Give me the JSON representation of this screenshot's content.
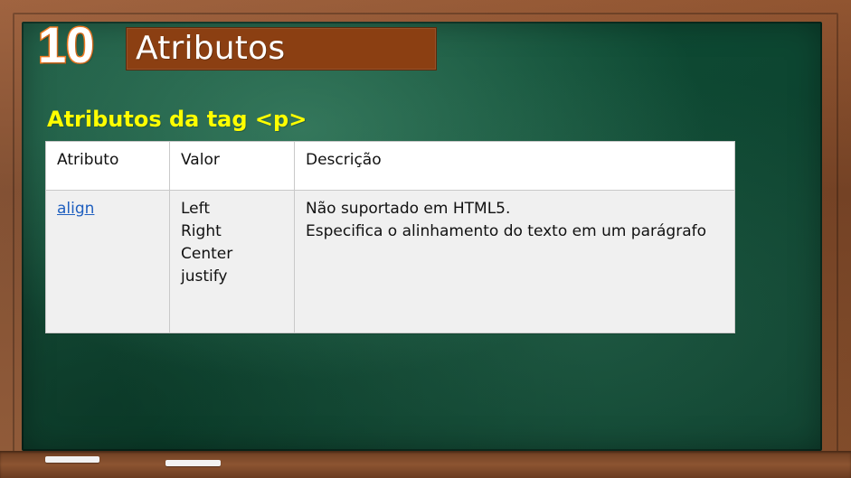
{
  "slide": {
    "number": "10",
    "title": "Atributos",
    "subheading": "Atributos da tag <p>"
  },
  "table": {
    "headers": [
      "Atributo",
      "Valor",
      "Descrição"
    ],
    "rows": [
      {
        "attribute": "align",
        "values": [
          "Left",
          "Right",
          "Center",
          "justify"
        ],
        "description": [
          "Não suportado em HTML5.",
          "Especifica o alinhamento do texto em um parágrafo"
        ]
      }
    ]
  },
  "colors": {
    "board_green": "#0e4b34",
    "frame_wood": "#7b4627",
    "title_bar": "#8b3f12",
    "subheading_yellow": "#ffff00",
    "slide_number_outline": "#f07a22",
    "link_blue": "#1f5fbf"
  }
}
